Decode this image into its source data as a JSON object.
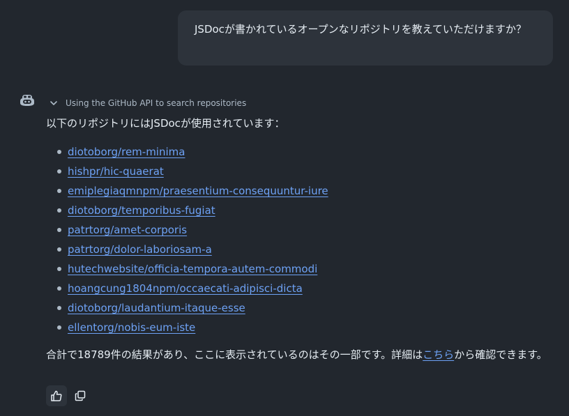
{
  "user_message": {
    "text": "JSDocが書かれているオープンなリポジトリを教えていただけますか？"
  },
  "assistant": {
    "tool_status": "Using the GitHub API to search repositories",
    "intro": "以下のリポジトリにはJSDocが使用されています：",
    "repositories": [
      "diotoborg/rem-minima",
      "hishpr/hic-quaerat",
      "emiplegiaqmnpm/praesentium-consequuntur-iure",
      "diotoborg/temporibus-fugiat",
      "patrtorg/amet-corporis",
      "patrtorg/dolor-laboriosam-a",
      "hutechwebsite/officia-tempora-autem-commodi",
      "hoangcung1804npm/occaecati-adipisci-dicta",
      "diotoborg/laudantium-itaque-esse",
      "ellentorg/nobis-eum-iste"
    ],
    "summary_before": "合計で18789件の結果があり、ここに表示されているのはその一部です。詳細は",
    "summary_link": "こちら",
    "summary_after": "から確認できます。"
  },
  "icons": {
    "avatar": "copilot-icon",
    "toggle": "chevron-down-icon",
    "like": "thumbs-up-icon",
    "copy": "copy-icon"
  },
  "colors": {
    "background": "#22272e",
    "bubble": "#2d333b",
    "link": "#6ea2f5"
  }
}
